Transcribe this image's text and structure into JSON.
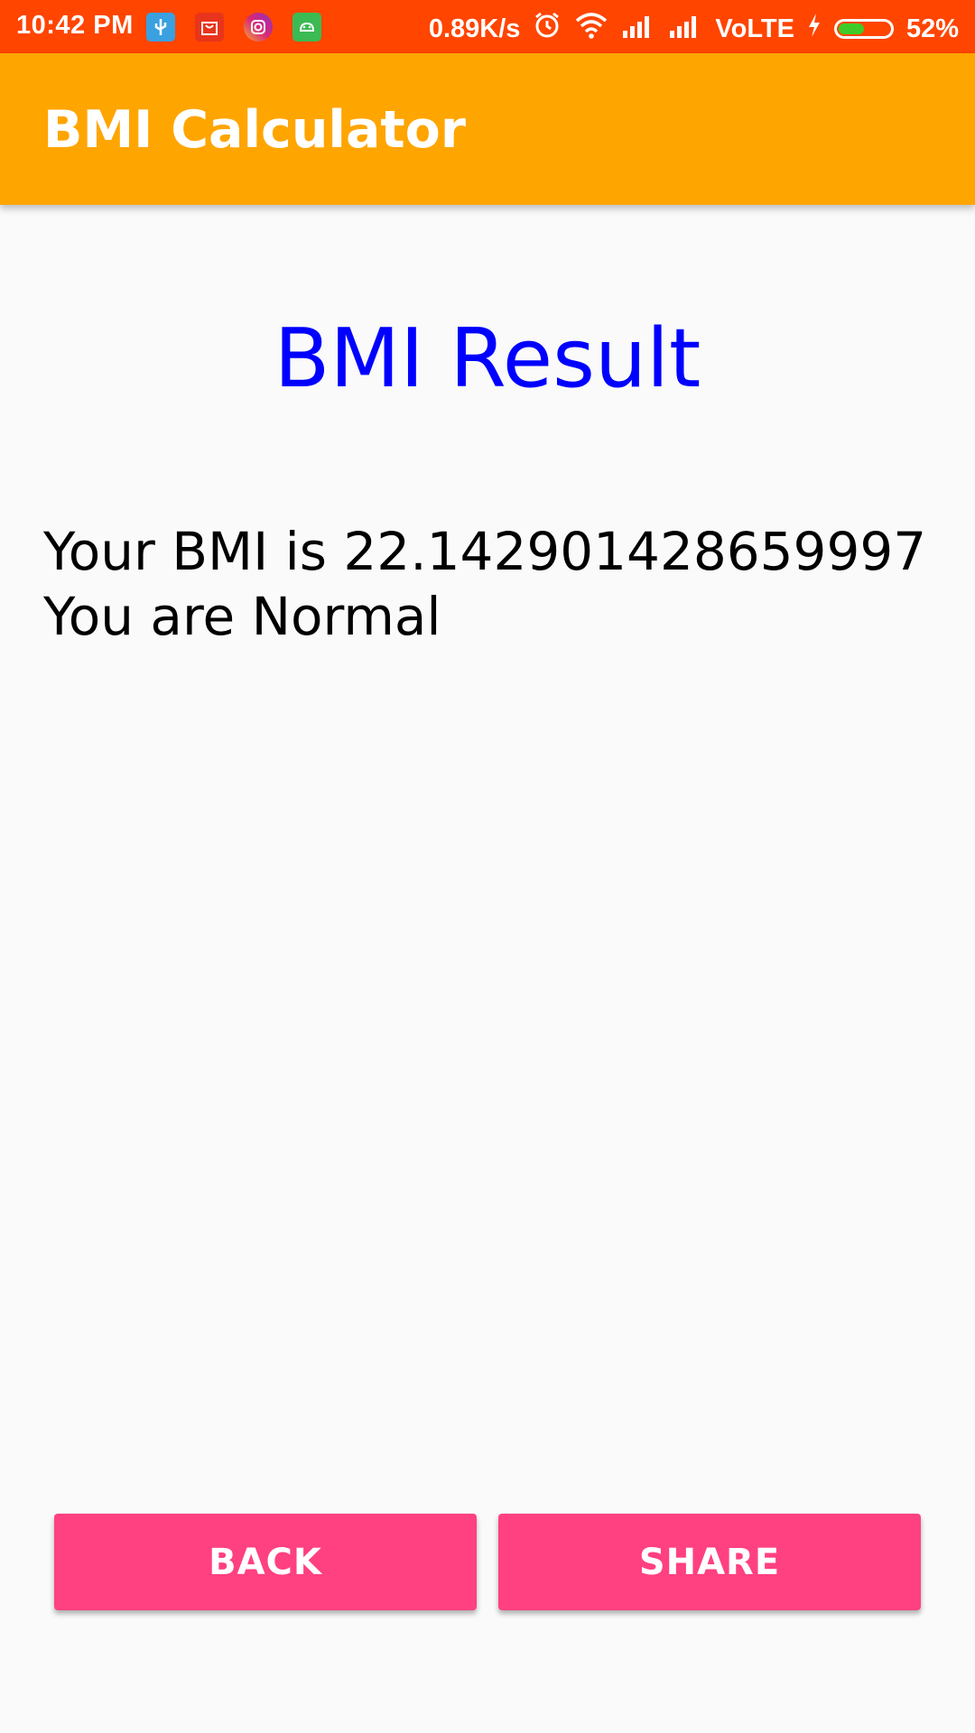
{
  "status_bar": {
    "time": "10:42 PM",
    "network_speed": "0.89K/s",
    "network_type": "VoLTE",
    "battery_percent": "52%",
    "battery_level": 0.52,
    "background_color": "#ff4500",
    "notification_icons": [
      "usb-icon",
      "shopping-bag-icon",
      "instagram-icon",
      "android-icon"
    ]
  },
  "app_bar": {
    "title": "BMI Calculator",
    "background_color": "#ffa500"
  },
  "content": {
    "heading": "BMI Result",
    "heading_color": "#0000ff",
    "bmi_line": "Your BMI is 22.142901428659997",
    "category_line": "You are Normal"
  },
  "buttons": {
    "back_label": "BACK",
    "share_label": "SHARE",
    "color": "#ff4081"
  }
}
